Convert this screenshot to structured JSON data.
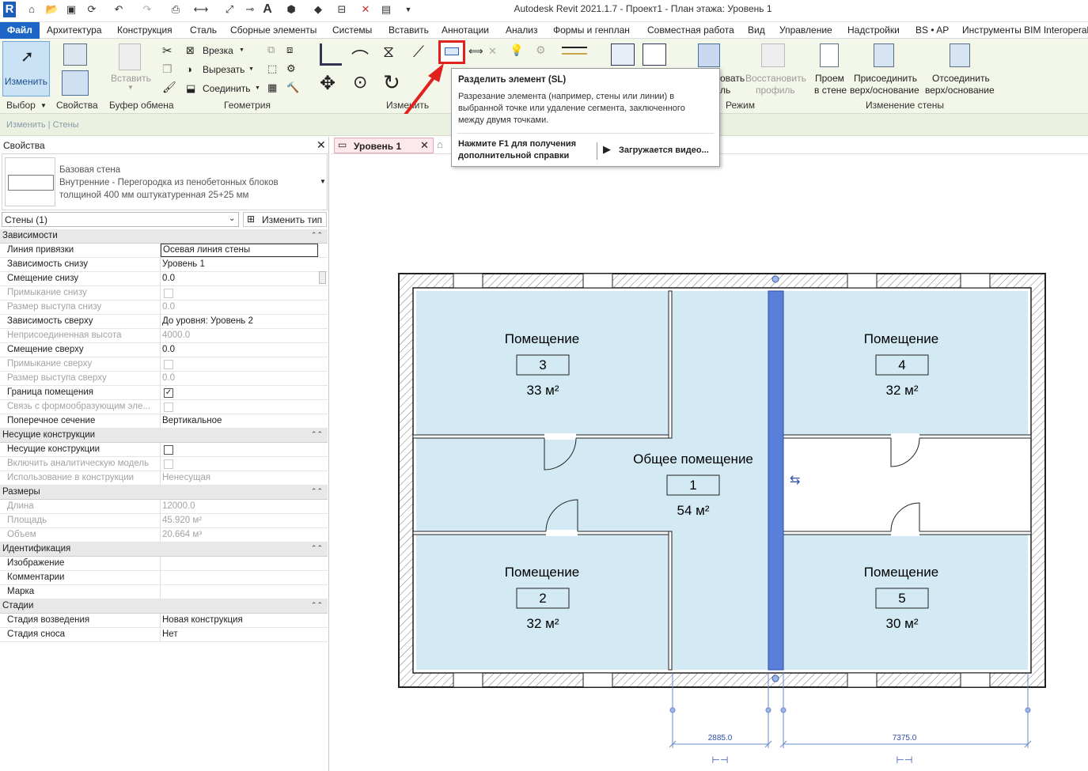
{
  "app": {
    "title": "Autodesk Revit 2021.1.7 - Проект1 - План этажа: Уровень 1",
    "logo": "R"
  },
  "menu": {
    "items": [
      "Файл",
      "Архитектура",
      "Конструкция",
      "Сталь",
      "Сборные элементы",
      "Системы",
      "Вставить",
      "Аннотации",
      "Анализ",
      "Формы и генплан",
      "Совместная работа",
      "Вид",
      "Управление",
      "Надстройки",
      "BS • AP",
      "Инструменты BIM Interoperal"
    ]
  },
  "ribbon": {
    "modify_label": "Изменить",
    "properties_label": "Свойства",
    "paste_label": "Вставить",
    "cut_label": "Врезка",
    "trim_label": "Вырезать",
    "join_label": "Соединить",
    "edit_profile": "овать",
    "edit_profile2": "ль",
    "restore_profile": "Восстановить",
    "restore_profile2": "профиль",
    "opening": "Проем",
    "opening2": "в стене",
    "attach": "Присоединить",
    "attach2": "верх/основание",
    "detach": "Отсоединить",
    "detach2": "верх/основание",
    "groups": {
      "select": "Выбор",
      "properties": "Свойства",
      "clipboard": "Буфер обмена",
      "geometry": "Геометрия",
      "modify": "Изменить",
      "mode": "Режим",
      "wall_change": "Изменение стены"
    },
    "accent": "#e0211d"
  },
  "context_bar": "Изменить | Стены",
  "tooltip": {
    "title": "Разделить элемент (SL)",
    "line1": "Разрезание элемента (например, стены или линии) в",
    "line2": "выбранной точке или удаление сегмента, заключенного",
    "line3": "между двумя точками.",
    "f1_1": "Нажмите F1 для получения",
    "f1_2": "дополнительной справки",
    "video": "Загружается видео..."
  },
  "properties": {
    "header": "Свойства",
    "type_family": "Базовая стена",
    "type_name1": "Внутренние - Перегородка из пенобетонных блоков",
    "type_name2": "толщиной 400 мм оштукатуренная 25+25 мм",
    "selector": "Стены (1)",
    "edit_type": "Изменить тип",
    "rows": [
      {
        "kind": "sec",
        "k": "Зависимости"
      },
      {
        "k": "Линия привязки",
        "v": "Осевая линия стены",
        "boxed": true
      },
      {
        "k": "Зависимость снизу",
        "v": "Уровень 1"
      },
      {
        "k": "Смещение снизу",
        "v": "0.0"
      },
      {
        "k": "Примыкание снизу",
        "v": "",
        "dis": true,
        "cb": ""
      },
      {
        "k": "Размер выступа снизу",
        "v": "0.0",
        "dis": true
      },
      {
        "k": "Зависимость сверху",
        "v": "До уровня: Уровень 2"
      },
      {
        "k": "Неприсоединенная высота",
        "v": "4000.0",
        "dis": true
      },
      {
        "k": "Смещение сверху",
        "v": "0.0"
      },
      {
        "k": "Примыкание сверху",
        "v": "",
        "dis": true,
        "cb": ""
      },
      {
        "k": "Размер выступа сверху",
        "v": "0.0",
        "dis": true
      },
      {
        "k": "Граница помещения",
        "v": "",
        "cb": "✓"
      },
      {
        "k": "Связь с формообразующим эле...",
        "v": "",
        "dis": true,
        "cb": ""
      },
      {
        "k": "Поперечное сечение",
        "v": "Вертикальное"
      },
      {
        "kind": "sec",
        "k": "Несущие конструкции"
      },
      {
        "k": "Несущие конструкции",
        "v": "",
        "cb": ""
      },
      {
        "k": "Включить аналитическую модель",
        "v": "",
        "dis": true,
        "cb": ""
      },
      {
        "k": "Использование в конструкции",
        "v": "Ненесущая",
        "dis": true
      },
      {
        "kind": "sec",
        "k": "Размеры"
      },
      {
        "k": "Длина",
        "v": "12000.0",
        "dis": true
      },
      {
        "k": "Площадь",
        "v": "45.920 м²",
        "dis": true
      },
      {
        "k": "Объем",
        "v": "20.664 м³",
        "dis": true
      },
      {
        "kind": "sec",
        "k": "Идентификация"
      },
      {
        "k": "Изображение",
        "v": ""
      },
      {
        "k": "Комментарии",
        "v": ""
      },
      {
        "k": "Марка",
        "v": ""
      },
      {
        "kind": "sec",
        "k": "Стадии"
      },
      {
        "k": "Стадия возведения",
        "v": "Новая конструкция"
      },
      {
        "k": "Стадия сноса",
        "v": "Нет"
      }
    ]
  },
  "view_tab": "Уровень 1",
  "plan": {
    "rooms": [
      {
        "name": "Помещение",
        "number": "3",
        "area": "33 м²"
      },
      {
        "name": "Помещение",
        "number": "4",
        "area": "32 м²"
      },
      {
        "name": "Общее помещение",
        "number": "1",
        "area": "54 м²"
      },
      {
        "name": "Помещение",
        "number": "2",
        "area": "32 м²"
      },
      {
        "name": "Помещение",
        "number": "5",
        "area": "30 м²"
      }
    ],
    "dims": [
      "2885.0",
      "7375.0"
    ],
    "room_fill": "#d3eaf5",
    "selected_wall": "#5a7fd8"
  }
}
